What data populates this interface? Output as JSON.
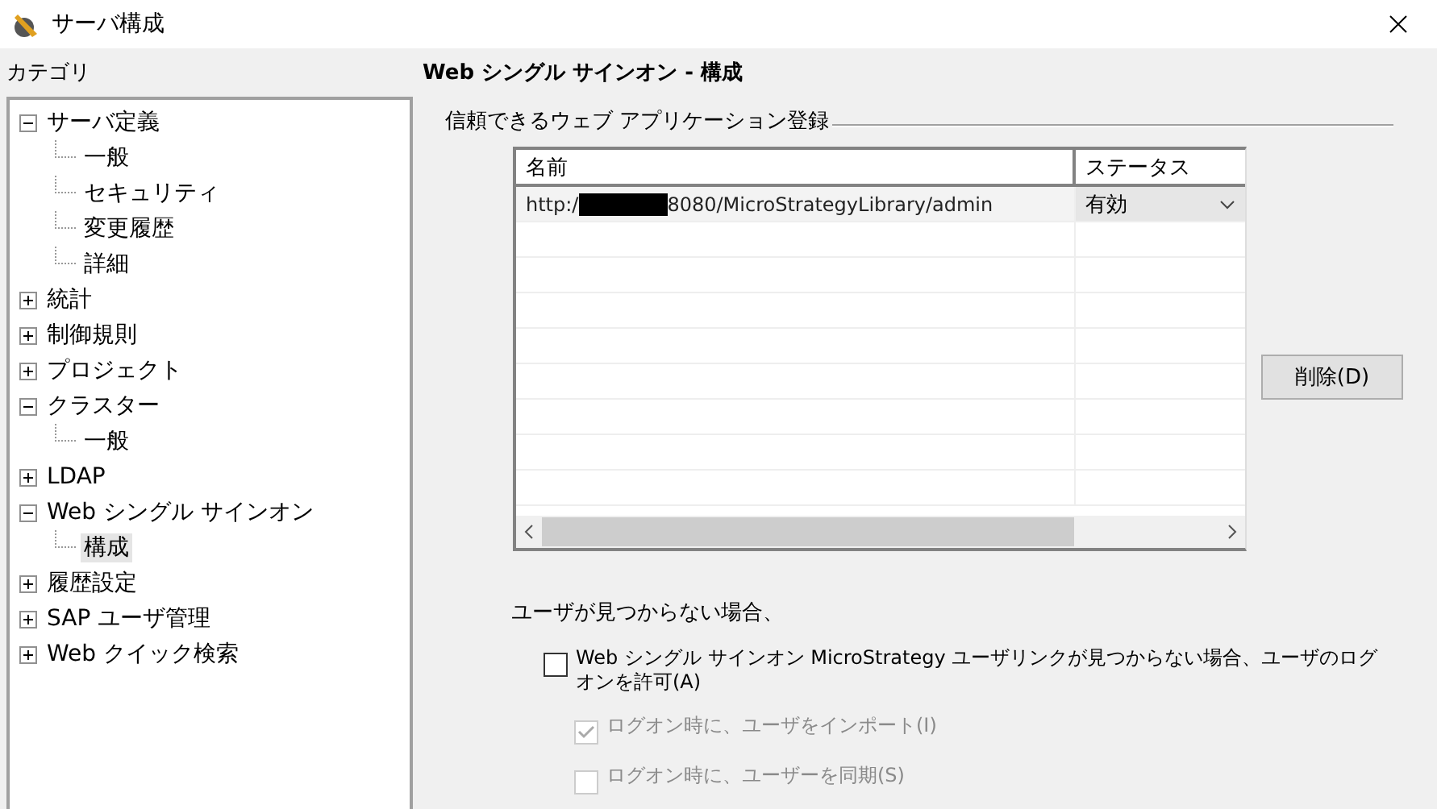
{
  "window": {
    "title": "サーバ構成"
  },
  "category_label": "カテゴリ",
  "tree": [
    {
      "label": "サーバ定義",
      "expanded": true,
      "selected": false,
      "children": [
        {
          "label": "一般",
          "selected": false
        },
        {
          "label": "セキュリティ",
          "selected": false
        },
        {
          "label": "変更履歴",
          "selected": false
        },
        {
          "label": "詳細",
          "selected": false
        }
      ]
    },
    {
      "label": "統計",
      "expanded": false,
      "selected": false
    },
    {
      "label": "制御規則",
      "expanded": false,
      "selected": false
    },
    {
      "label": "プロジェクト",
      "expanded": false,
      "selected": false
    },
    {
      "label": "クラスター",
      "expanded": true,
      "selected": false,
      "children": [
        {
          "label": "一般",
          "selected": false
        }
      ]
    },
    {
      "label": "LDAP",
      "expanded": false,
      "selected": false
    },
    {
      "label": "Web シングル サインオン",
      "expanded": true,
      "selected": false,
      "children": [
        {
          "label": "構成",
          "selected": true
        }
      ]
    },
    {
      "label": "履歴設定",
      "expanded": false,
      "selected": false
    },
    {
      "label": "SAP ユーザ管理",
      "expanded": false,
      "selected": false
    },
    {
      "label": "Web クイック検索",
      "expanded": false,
      "selected": false
    }
  ],
  "panel_title": "Web シングル サインオン - 構成",
  "group_title": "信頼できるウェブ アプリケーション登録",
  "table": {
    "columns": [
      "名前",
      "ステータス"
    ],
    "rows": [
      {
        "url_prefix": "http:/",
        "url_suffix": "8080/MicroStrategyLibrary/admin",
        "status": "有効",
        "selected": true
      }
    ]
  },
  "delete_button": "削除(D)",
  "not_found_label": "ユーザが見つからない場合、",
  "checkboxes": [
    {
      "label": "Web シングル サインオン MicroStrategy ユーザリンクが見つからない場合、ユーザのログオンを許可(A)",
      "checked": false,
      "disabled": false,
      "indented": false
    },
    {
      "label": "ログオン時に、ユーザをインポート(I)",
      "checked": true,
      "disabled": true,
      "indented": true
    },
    {
      "label": "ログオン時に、ユーザーを同期(S)",
      "checked": false,
      "disabled": true,
      "indented": true
    }
  ]
}
